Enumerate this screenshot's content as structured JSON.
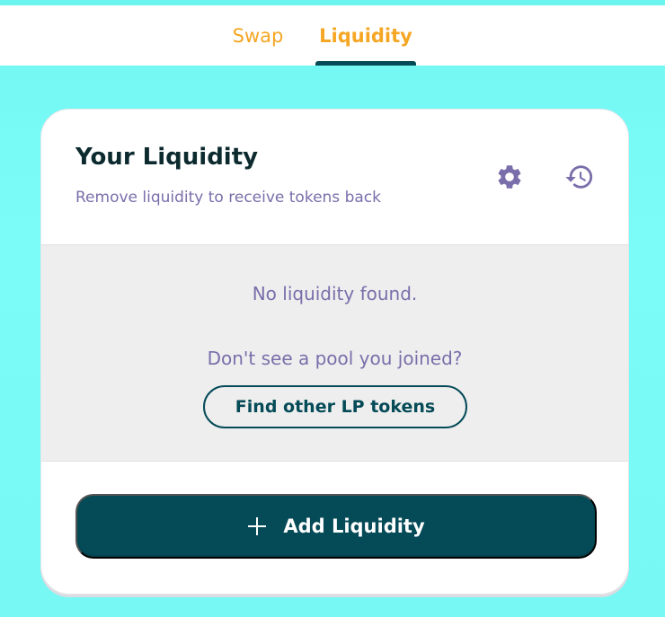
{
  "tabs": [
    {
      "label": "Swap",
      "active": false
    },
    {
      "label": "Liquidity",
      "active": true
    }
  ],
  "card": {
    "title": "Your Liquidity",
    "subtitle": "Remove liquidity to receive tokens back",
    "icons": [
      "settings-gear-icon",
      "history-clock-icon"
    ]
  },
  "empty_state": {
    "message": "No liquidity found.",
    "question": "Don't see a pool you joined?",
    "find_button": "Find other LP tokens"
  },
  "add_button": {
    "icon": "plus-icon",
    "label": "Add Liquidity"
  },
  "colors": {
    "background": "#7cfcf8",
    "accent_orange": "#f5a623",
    "primary_teal": "#044a57",
    "text_purple": "#7a6eaa",
    "title_dark": "#0d2b2f",
    "empty_bg": "#eeeeee"
  }
}
